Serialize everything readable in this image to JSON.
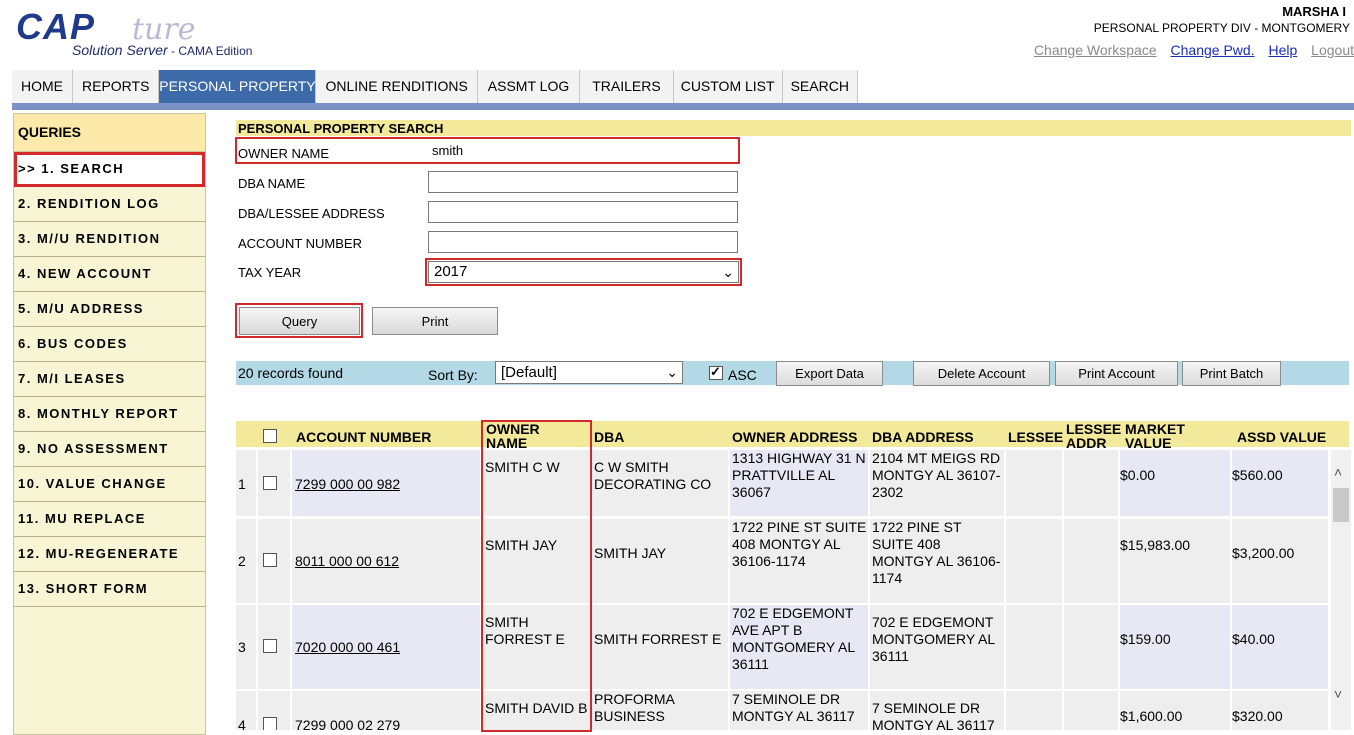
{
  "header": {
    "logo_main": "CAP",
    "logo_script": "ture",
    "logo_sub": "Solution Server",
    "logo_edition": " - CAMA Edition",
    "user": "MARSHA   I",
    "division": "PERSONAL PROPERTY DIV  -  MONTGOMERY",
    "links": [
      "Change Workspace",
      "Change Pwd.",
      "Help",
      "Logout"
    ]
  },
  "nav": {
    "tabs": [
      "HOME",
      "REPORTS",
      "PERSONAL PROPERTY",
      "ONLINE RENDITIONS",
      "ASSMT LOG",
      "TRAILERS",
      "CUSTOM LIST",
      "SEARCH"
    ],
    "active": "PERSONAL PROPERTY"
  },
  "sidebar": {
    "title": "QUERIES",
    "items": [
      ">> 1. SEARCH",
      "2. RENDITION LOG",
      "3. M//U RENDITION",
      "4. NEW ACCOUNT",
      "5. M/U ADDRESS",
      "6. BUS CODES",
      "7. M/I LEASES",
      "8. MONTHLY REPORT",
      "9. NO ASSESSMENT",
      "10. VALUE CHANGE",
      "11. MU REPLACE",
      "12. MU-REGENERATE",
      "13. SHORT FORM"
    ]
  },
  "search": {
    "title": "PERSONAL PROPERTY SEARCH",
    "owner_label": "OWNER NAME",
    "owner_value": "smith",
    "dba_label": "DBA NAME",
    "dba_value": "",
    "address_label": "DBA/LESSEE ADDRESS",
    "address_value": "",
    "account_label": "ACCOUNT NUMBER",
    "account_value": "",
    "year_label": "TAX YEAR",
    "year_value": "2017",
    "query_btn": "Query",
    "print_btn": "Print"
  },
  "results": {
    "count": "20 records found",
    "sort_label": "Sort By:",
    "sort_value": "[Default]",
    "asc_label": "ASC",
    "asc_checked": true,
    "buttons": [
      "Export Data",
      "Delete Account",
      "Print Account",
      "Print Batch"
    ]
  },
  "table": {
    "headers": {
      "account": "ACCOUNT NUMBER",
      "owner": "OWNER NAME",
      "dba": "DBA",
      "owner_addr": "OWNER ADDRESS",
      "dba_addr": "DBA ADDRESS",
      "lessee": "LESSEE",
      "lessee_addr": "LESSEE ADDR",
      "market": "MARKET VALUE",
      "assd": "ASSD VALUE"
    },
    "rows": [
      {
        "num": "1",
        "account": "7299 000 00 982",
        "owner": "SMITH C W",
        "dba": "C W SMITH DECORATING CO",
        "owner_addr": "1313 HIGHWAY 31 N PRATTVILLE AL 36067",
        "dba_addr": "2104 MT MEIGS RD MONTGY AL 36107-2302",
        "market": "$0.00",
        "assd": "$560.00"
      },
      {
        "num": "2",
        "account": "8011 000 00 612",
        "owner": "SMITH JAY",
        "dba": "SMITH JAY",
        "owner_addr": "1722 PINE ST SUITE 408 MONTGY AL 36106-1174",
        "dba_addr": "1722 PINE ST SUITE 408 MONTGY AL 36106-1174",
        "market": "$15,983.00",
        "assd": "$3,200.00"
      },
      {
        "num": "3",
        "account": "7020 000 00 461",
        "owner": "SMITH FORREST E",
        "dba": "SMITH FORREST E",
        "owner_addr": "702 E EDGEMONT AVE APT B MONTGOMERY AL 36111",
        "dba_addr": "702 E EDGEMONT MONTGOMERY AL 36111",
        "market": "$159.00",
        "assd": "$40.00"
      },
      {
        "num": "4",
        "account": "7299 000 02 279",
        "owner": "SMITH DAVID B",
        "dba": "PROFORMA BUSINESS",
        "owner_addr": "7 SEMINOLE DR MONTGY AL 36117",
        "dba_addr": "7 SEMINOLE DR MONTGY AL 36117",
        "market": "$1,600.00",
        "assd": "$320.00"
      }
    ]
  }
}
